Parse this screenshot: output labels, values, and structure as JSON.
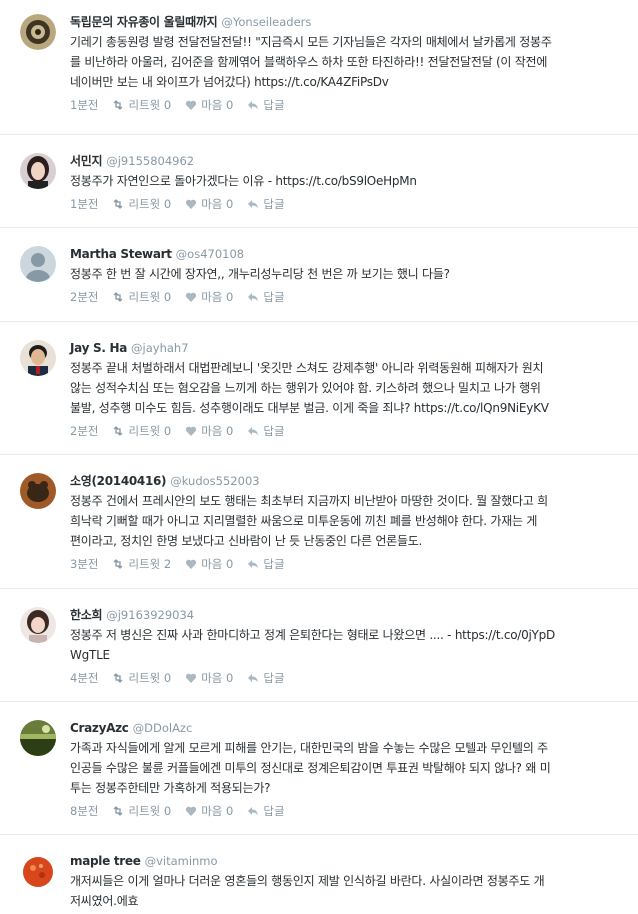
{
  "tweets": [
    {
      "name": "독립문의 자유종이 울릴때까지",
      "handle": "@Yonseileaders",
      "lines": [
        "기레기 총동원령 발령 전달전달전달!! \"지금즉시 모든 기자님들은 각자의 매체에서 날카롭게 정봉주",
        "를 비난하라 아울러, 김어준을 함께엮어 블랙하우스 하차 또한 타진하라!! 전달전달전달 (이 작전에",
        "네이버만 보는 내 와이프가 넘어갔다) https://t.co/KA4ZFiPsDv"
      ],
      "time": "1분전",
      "retweet": "리트윗",
      "retweet_count": "0",
      "like": "마음",
      "like_count": "0",
      "reply": "답글",
      "avatar": "emblem"
    },
    {
      "name": "서민지",
      "handle": "@j9155804962",
      "lines": [
        "정봉주가 자연인으로 돌아가겠다는 이유 - https://t.co/bS9lOeHpMn"
      ],
      "time": "1분전",
      "retweet": "리트윗",
      "retweet_count": "0",
      "like": "마음",
      "like_count": "0",
      "reply": "답글",
      "avatar": "woman"
    },
    {
      "name": "Martha Stewart",
      "handle": "@os470108",
      "lines": [
        "정봉주 한 번 잘 시간에 장자연,, 개누리성누리당 천 번은 까 보기는 했니 다들?"
      ],
      "time": "2분전",
      "retweet": "리트윗",
      "retweet_count": "0",
      "like": "마음",
      "like_count": "0",
      "reply": "답글",
      "avatar": "default"
    },
    {
      "name": "Jay S. Ha",
      "handle": "@jayhah7",
      "lines": [
        "정봉주 끝내 처벌하래서 대법판례보니 '옷깃만 스쳐도 강제추행' 아니라 위력동원해 피해자가 원치",
        "않는 성적수치심 또는 혐오감을 느끼게 하는 행위가 있어야 함. 키스하려 했으나 밀치고 나가 행위",
        "불발, 성추행 미수도 힘듬. 성추행이래도 대부분 벌금. 이게 죽을 죄냐? https://t.co/lQn9NiEyKV"
      ],
      "time": "2분전",
      "retweet": "리트윗",
      "retweet_count": "0",
      "like": "마음",
      "like_count": "0",
      "reply": "답글",
      "avatar": "man"
    },
    {
      "name": "소영(20140416)",
      "handle": "@kudos552003",
      "lines": [
        "정봉주 건에서 프레시안의 보도 행태는 최초부터 지금까지 비난받아 마땅한 것이다. 뭘 잘했다고 희",
        "희낙락 기뻐할 때가 아니고 지리멸렬한 싸움으로 미투운동에 끼친 폐를 반성해야 한다. 가재는 게",
        "편이라고, 정치인 한명 보냈다고 신바람이 난 듯 난동중인 다른 언론들도."
      ],
      "time": "3분전",
      "retweet": "리트윗",
      "retweet_count": "2",
      "like": "마음",
      "like_count": "0",
      "reply": "답글",
      "avatar": "animal"
    },
    {
      "name": "한소희",
      "handle": "@j9163929034",
      "lines": [
        "정봉주 저 병신은 진짜 사과 한마디하고 정계 은퇴한다는 형태로 나왔으면 .... - https://t.co/0jYpD",
        "WgTLE"
      ],
      "time": "4분전",
      "retweet": "리트윗",
      "retweet_count": "0",
      "like": "마음",
      "like_count": "0",
      "reply": "답글",
      "avatar": "woman2"
    },
    {
      "name": "CrazyAzc",
      "handle": "@DDolAzc",
      "lines": [
        "가족과 자식들에게 알게 모르게 피해를 안기는, 대한민국의 밤을 수놓는 수많은 모텔과 무인텔의 주",
        "인공들 수많은 불륜 커플들에겐 미투의 정신대로 정계은퇴감이면 투표권 박탈해야 되지 않나? 왜 미",
        "투는 정봉주한테만 가혹하게 적용되는가?"
      ],
      "time": "8분전",
      "retweet": "리트윗",
      "retweet_count": "0",
      "like": "마음",
      "like_count": "0",
      "reply": "답글",
      "avatar": "landscape"
    },
    {
      "name": "maple tree",
      "handle": "@vitaminmo",
      "lines": [
        "개저씨들은 이게 얼마나 더러운 영혼들의 행동인지 제발 인식하길 바란다. 사실이라면 정봉주도 개",
        "저씨였어.에효"
      ],
      "time": "",
      "retweet": "",
      "retweet_count": "",
      "like": "",
      "like_count": "",
      "reply": "",
      "avatar": "berry"
    }
  ],
  "colors": {
    "name": "#292f33",
    "meta": "#8899a6",
    "divider": "#e6ecf0"
  }
}
